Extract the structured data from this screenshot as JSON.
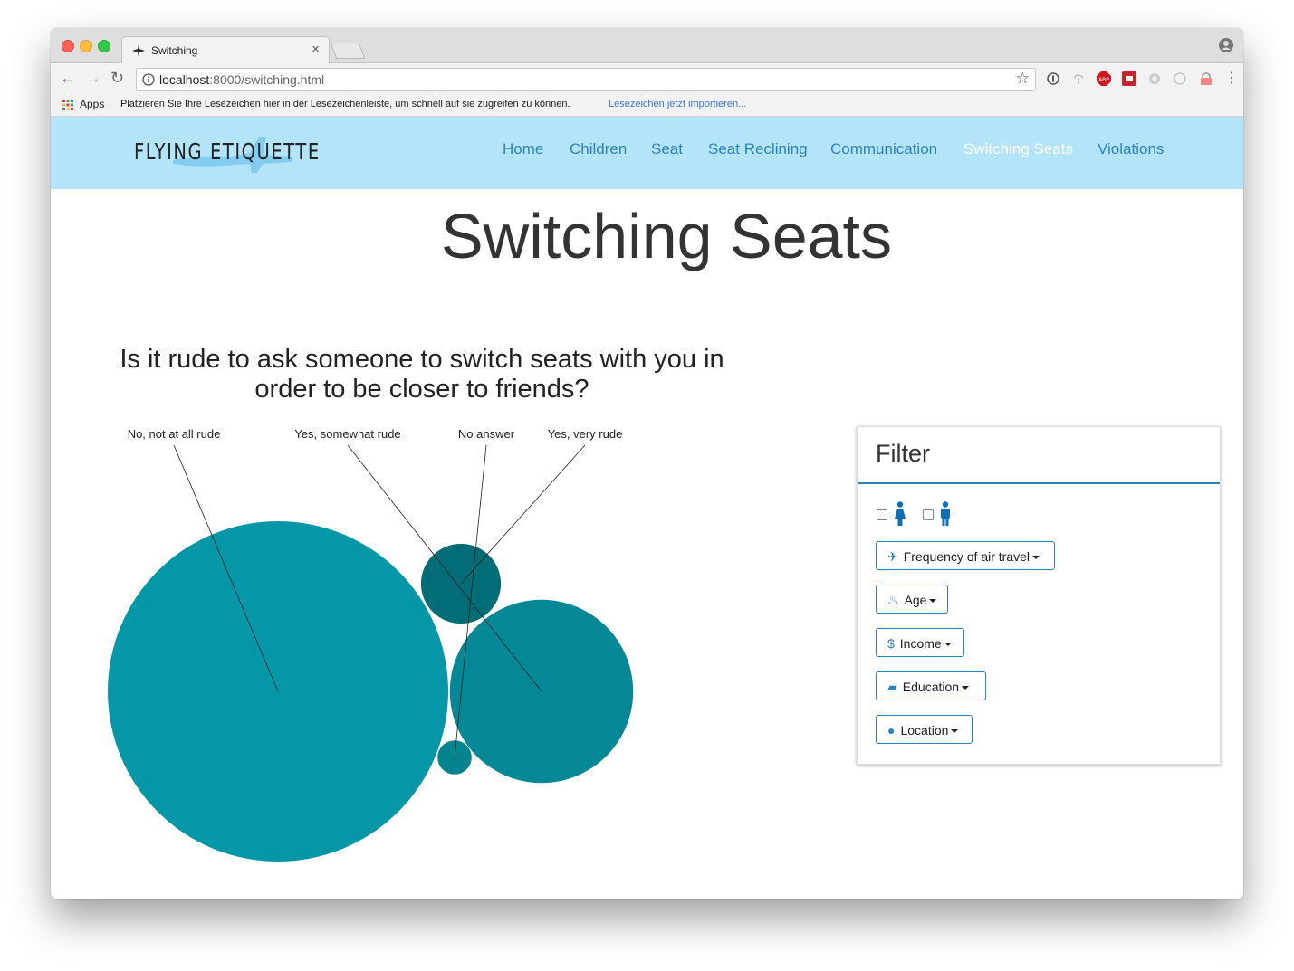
{
  "browser": {
    "tab_title": "Switching",
    "url_host": "localhost",
    "url_rest": ":8000/switching.html",
    "apps_label": "Apps",
    "bookmarks_hint": "Platzieren Sie Ihre Lesezeichen hier in der Lesezeichenleiste, um schnell auf sie zugreifen zu können.",
    "bookmarks_import": "Lesezeichen jetzt importieren..."
  },
  "site": {
    "logo": "FLYING ETIQUETTE",
    "nav": [
      "Home",
      "Children",
      "Seat",
      "Seat Reclining",
      "Communication",
      "Switching Seats",
      "Violations"
    ],
    "active_nav": "Switching Seats"
  },
  "page": {
    "title": "Switching Seats",
    "question": "Is it rude to ask someone to switch seats with you in order to be closer to friends?"
  },
  "chart_data": {
    "type": "bubble",
    "title": "Is it rude to ask someone to switch seats with you in order to be closer to friends?",
    "series": [
      {
        "name": "No, not at all rude",
        "relative_size": 1.0,
        "color": "#0597a8"
      },
      {
        "name": "Yes, somewhat rude",
        "relative_size": 0.29,
        "color": "#058896"
      },
      {
        "name": "No answer",
        "relative_size": 0.01,
        "color": "#05838f"
      },
      {
        "name": "Yes, very rude",
        "relative_size": 0.055,
        "color": "#026d76"
      }
    ]
  },
  "filter": {
    "title": "Filter",
    "buttons": [
      {
        "label": "Frequency of air travel",
        "icon": "plane-icon"
      },
      {
        "label": "Age",
        "icon": "cake-icon"
      },
      {
        "label": "Income",
        "icon": "dollar-icon"
      },
      {
        "label": "Education",
        "icon": "graduation-cap-icon"
      },
      {
        "label": "Location",
        "icon": "map-marker-icon"
      }
    ]
  },
  "colors": {
    "nav_bg": "#b3e4fa",
    "accent": "#2b83bd",
    "bubble_main": "#0597a8",
    "bubble_dark": "#026d76"
  }
}
